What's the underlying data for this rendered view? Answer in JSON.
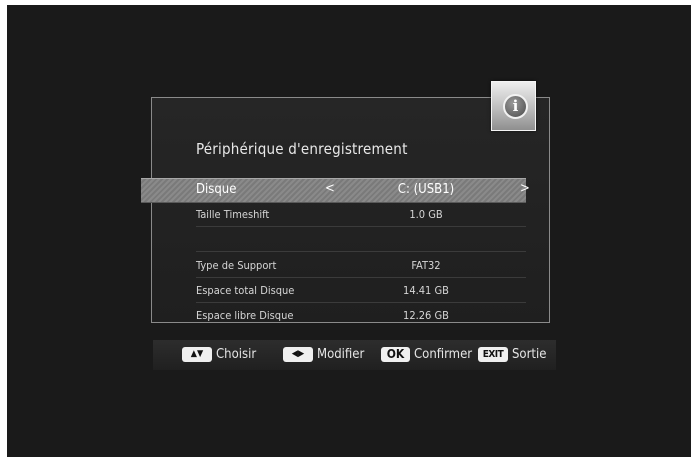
{
  "dialog": {
    "title": "Périphérique d'enregistrement",
    "info_icon_glyph": "i"
  },
  "rows": [
    {
      "label": "Disque",
      "value": "C: (USB1)",
      "left_arrow": "<",
      "right_arrow": ">"
    },
    {
      "label": "Taille Timeshift",
      "value": "1.0 GB"
    },
    {
      "label": "",
      "value": ""
    },
    {
      "label": "Type de Support",
      "value": "FAT32"
    },
    {
      "label": "Espace total Disque",
      "value": "14.41 GB"
    },
    {
      "label": "Espace libre Disque",
      "value": "12.26 GB"
    }
  ],
  "footer": {
    "choose": "Choisir",
    "modify": "Modifier",
    "ok_key": "OK",
    "confirm": "Confirmer",
    "exit_key": "EXIT",
    "exit": "Sortie"
  },
  "icons": {
    "updown": "▲▼",
    "leftright": "◀▶"
  },
  "colors": {
    "background": "#1a1a1a",
    "highlight": "#888888",
    "text": "#e0e0e0"
  }
}
